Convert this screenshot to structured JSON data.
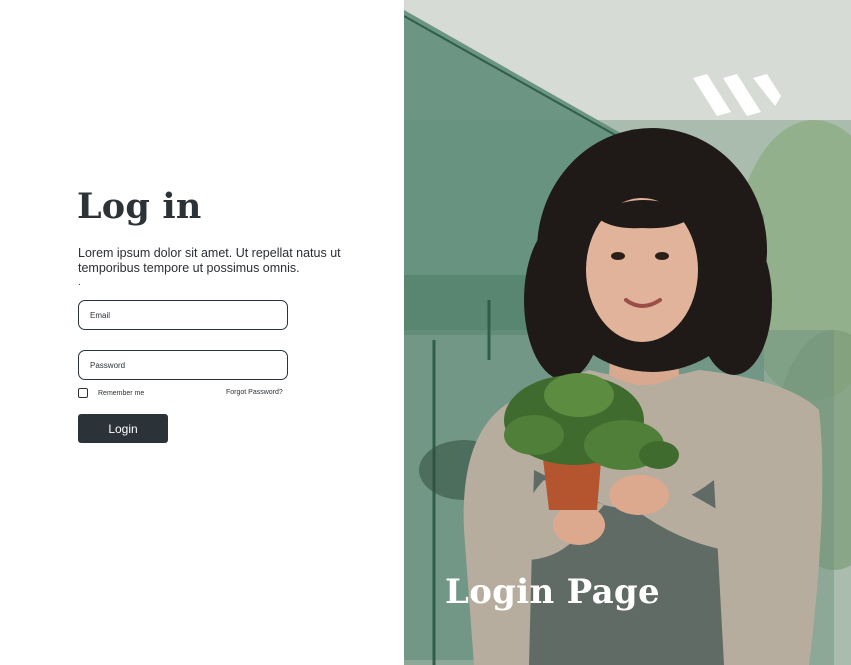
{
  "login": {
    "title": "Log in",
    "description": "Lorem ipsum dolor sit amet. Ut repellat natus ut temporibus tempore ut possimus omnis.",
    "description_dot": ".",
    "email_placeholder": "Email",
    "password_placeholder": "Password",
    "remember_label": "Remember me",
    "forgot_label": "Forgot Password?",
    "login_button": "Login"
  },
  "hero": {
    "title": "Login Page",
    "logo_icon": "w-logo-icon",
    "image_subject": "woman-holding-potted-plant-photo"
  },
  "colors": {
    "primary": "#2b3339",
    "background": "#ffffff",
    "hero_text": "#ffffff"
  }
}
